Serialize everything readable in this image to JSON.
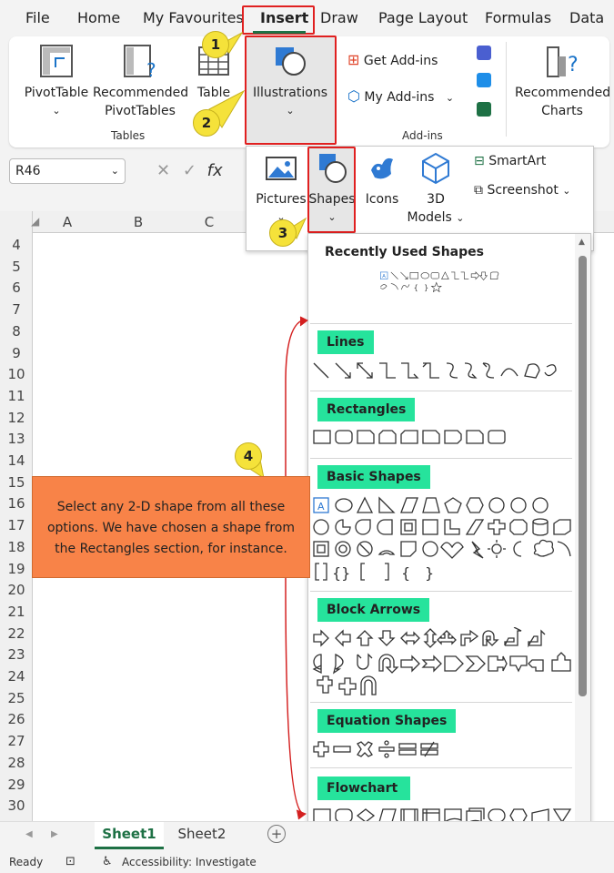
{
  "menu": {
    "file": "File",
    "home": "Home",
    "favourites": "My Favourites",
    "insert": "Insert",
    "draw": "Draw",
    "page_layout": "Page Layout",
    "formulas": "Formulas",
    "data": "Data"
  },
  "ribbon": {
    "pivottable": "PivotTable",
    "recommended_pivot_1": "Recommended",
    "recommended_pivot_2": "PivotTables",
    "table": "Table",
    "tables_group": "Tables",
    "illustrations": "Illustrations",
    "get_addins": "Get Add-ins",
    "my_addins": "My Add-ins",
    "addins_group": "Add-ins",
    "recommended_charts_1": "Recommended",
    "recommended_charts_2": "Charts"
  },
  "formula_bar": {
    "name_box": "R46",
    "fx": "fx"
  },
  "columns": [
    "A",
    "B",
    "C"
  ],
  "rows": [
    "4",
    "5",
    "6",
    "7",
    "8",
    "9",
    "10",
    "11",
    "12",
    "13",
    "14",
    "15",
    "16",
    "17",
    "18",
    "19",
    "20",
    "21",
    "22",
    "23",
    "24",
    "25",
    "26",
    "27",
    "28",
    "29",
    "30"
  ],
  "illustrations_menu": {
    "pictures": "Pictures",
    "shapes": "Shapes",
    "icons": "Icons",
    "models_1": "3D",
    "models_2": "Models",
    "smartart": "SmartArt",
    "screenshot": "Screenshot"
  },
  "shapes_menu": {
    "recent": "Recently Used Shapes",
    "lines": "Lines",
    "rectangles": "Rectangles",
    "basic": "Basic Shapes",
    "block_arrows": "Block Arrows",
    "equation": "Equation Shapes",
    "flowchart": "Flowchart"
  },
  "callout": {
    "text": "Select any 2-D shape from all these options. We have chosen a shape from the Rectangles section, for instance."
  },
  "badges": {
    "b1": "1",
    "b2": "2",
    "b3": "3",
    "b4": "4"
  },
  "sheets": {
    "sheet1": "Sheet1",
    "sheet2": "Sheet2"
  },
  "status": {
    "ready": "Ready",
    "accessibility": "Accessibility: Investigate"
  },
  "colors": {
    "accent": "#26e39c",
    "callout": "#f88348",
    "highlight": "#e02020",
    "badge": "#f5e23a"
  }
}
